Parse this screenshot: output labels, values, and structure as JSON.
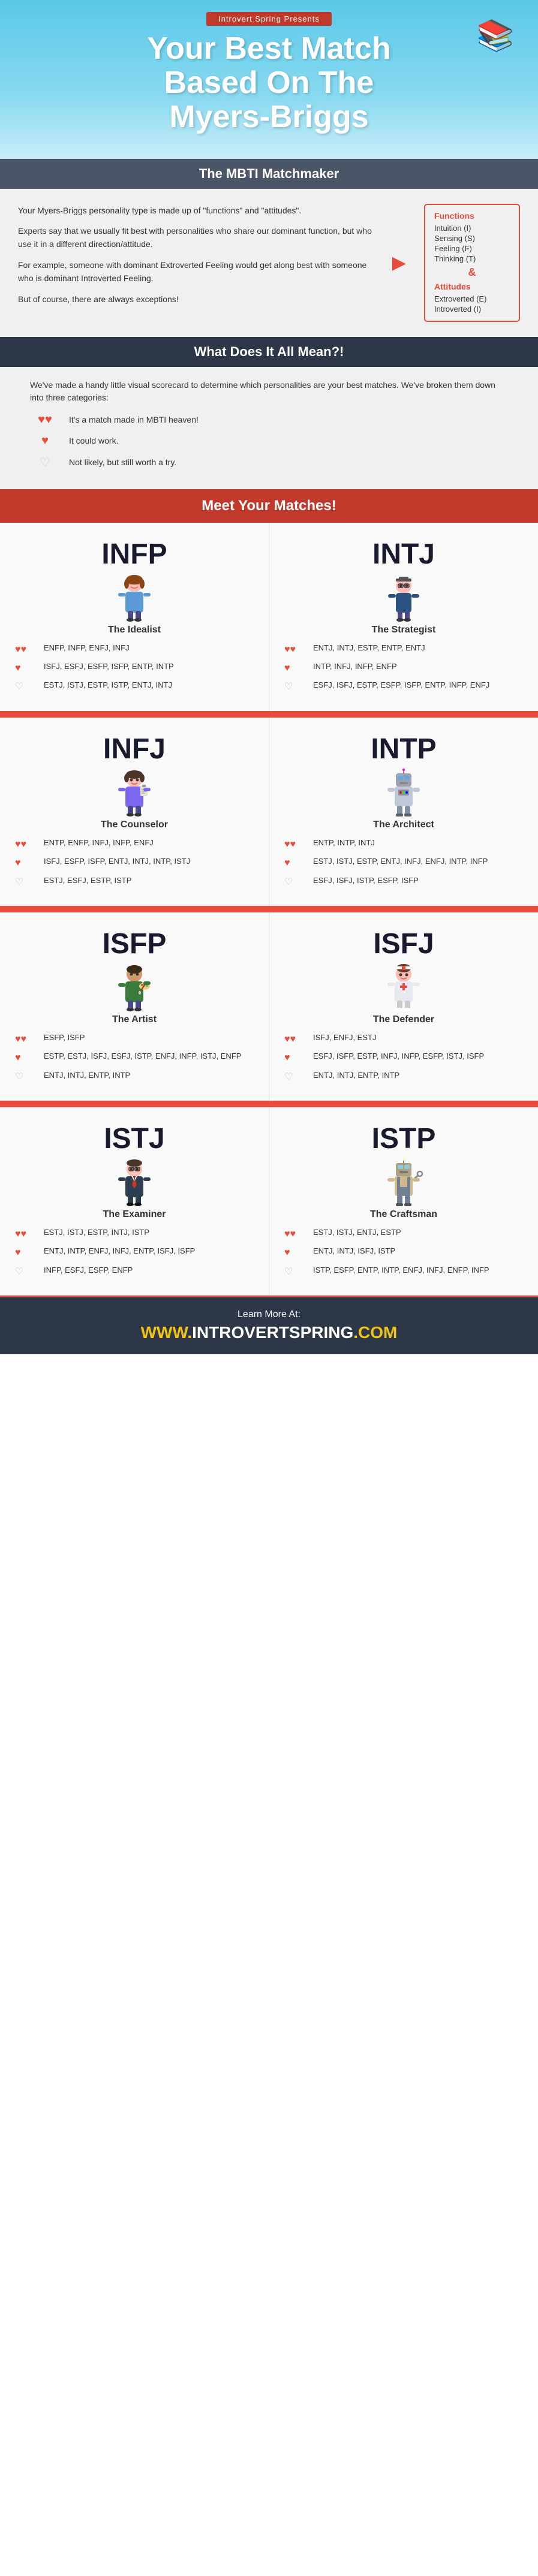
{
  "header": {
    "presents": "Introvert Spring Presents",
    "title_line1": "Your Best Match",
    "title_line2": "Based On The",
    "title_line3": "Myers-Briggs"
  },
  "matchmaker": {
    "section_title": "The MBTI Matchmaker",
    "paragraphs": [
      "Your Myers-Briggs personality type is made up of \"functions\" and \"attitudes\".",
      "Experts say that we usually fit best with personalities who share our dominant function, but who use it in a different direction/attitude.",
      "For example, someone with dominant Extroverted Feeling would get along best with someone who is dominant Introverted Feeling.",
      "But of course, there are always exceptions!"
    ],
    "functions_title": "Functions",
    "functions": [
      "Intuition (I)",
      "Sensing (S)",
      "Feeling (F)",
      "Thinking (T)"
    ],
    "attitudes_title": "Attitudes",
    "attitudes": [
      "Extroverted (E)",
      "Introverted (I)"
    ]
  },
  "meaning": {
    "section_title": "What Does It All Mean?!",
    "intro": "We've made a handy little visual scorecard to determine which personalities are your best matches. We've broken them down into three categories:",
    "levels": [
      {
        "hearts": "♥♥",
        "label": "It's a match made in MBTI heaven!"
      },
      {
        "hearts": "♥",
        "label": "It could work."
      },
      {
        "hearts": "♡",
        "label": "Not likely, but still worth a try."
      }
    ]
  },
  "meet": {
    "section_title": "Meet Your Matches!"
  },
  "types": [
    {
      "code": "INFP",
      "name": "The Idealist",
      "avatar": "👩",
      "best": "ENFP, INFP, ENFJ, INFJ",
      "could": "ISFJ, ESFJ, ESFP, ISFP, ENTP, INTP",
      "unlikely": "ESTJ, ISTJ, ESTP, ISTP, ENTJ, INTJ"
    },
    {
      "code": "INTJ",
      "name": "The Strategist",
      "avatar": "👨",
      "best": "ENTJ, INTJ, ESTP, ENTP, ENTJ",
      "could": "INTP, INFJ, INFP, ENFP",
      "unlikely": "ESFJ, ISFJ, ESTP, ESFP, ISFP, ENTP, INFP, ENFJ"
    },
    {
      "code": "INFJ",
      "name": "The Counselor",
      "avatar": "👩",
      "best": "ENTP, ENFP, INFJ, INFP, ENFJ",
      "could": "ISFJ, ESFP, ISFP, ENTJ, INTJ, INTP, ISTJ",
      "unlikely": "ESTJ, ESFJ, ESTP, ISTP"
    },
    {
      "code": "INTP",
      "name": "The Architect",
      "avatar": "🤖",
      "best": "ENTP, INTP, INTJ",
      "could": "ESTJ, ISTJ, ESTP, ENTJ, INFJ, ENFJ, INTP, INFP",
      "unlikely": "ESFJ, ISFJ, ISTP, ESFP, ISFP"
    },
    {
      "code": "ISFP",
      "name": "The Artist",
      "avatar": "🧑",
      "best": "ESFP, ISFP",
      "could": "ESTP, ESTJ, ISFJ, ESFJ, ISTP, ENFJ, INFP, ISTJ, ENFP",
      "unlikely": "ENTJ, INTJ, ENTP, INTP"
    },
    {
      "code": "ISFJ",
      "name": "The Defender",
      "avatar": "👩",
      "best": "ISFJ, ENFJ, ESTJ",
      "could": "ESFJ, ISFP, ESTP, INFJ, INFP, ESFP, ISTJ, ISFP",
      "unlikely": "ENTJ, INTJ, ENTP, INTP"
    },
    {
      "code": "ISTJ",
      "name": "The Examiner",
      "avatar": "👨",
      "best": "ESTJ, ISTJ, ESTP, INTJ, ISTP",
      "could": "ENTJ, INTP, ENFJ, INFJ, ENTP, ISFJ, ISFP",
      "unlikely": "INFP, ESFJ, ESFP, ENFP"
    },
    {
      "code": "ISTP",
      "name": "The Craftsman",
      "avatar": "🤖",
      "best": "ESTJ, ISTJ, ENTJ, ESTP",
      "could": "ENTJ, INTJ, ISFJ, ISTP",
      "unlikely": "ISTP, ESFP, ENTP, INTP, ENFJ, INFJ, ENFP, INFP"
    }
  ],
  "footer": {
    "learn_more": "Learn More At:",
    "website": "WWW.INTROVERTSPRING.COM"
  }
}
